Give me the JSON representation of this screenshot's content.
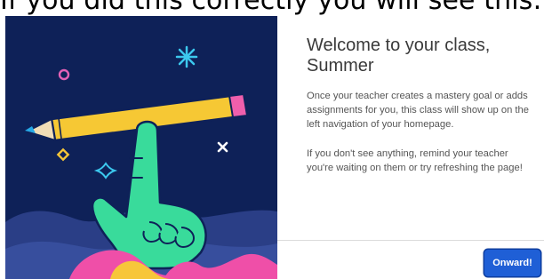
{
  "caption": "If you did this correctly you will see this:",
  "dialog": {
    "title": "Welcome to your class, Summer",
    "paragraphs": [
      "Once your teacher creates a mastery goal or adds assignments for you, this class will show up on the left navigation of your homepage.",
      "If you don't see anything, remind your teacher you're waiting on them or try refreshing the page!"
    ],
    "button_label": "Onward!"
  },
  "illustration": {
    "background_color": "#0e2158",
    "decorations": [
      "circle-icon",
      "asterisk-icon",
      "diamond-icon",
      "sparkle-icon",
      "close-icon"
    ],
    "subject": "hand-balancing-pencil"
  },
  "colors": {
    "button": "#1f5fd6",
    "title_text": "#3a3a3a",
    "body_text": "#555555"
  }
}
